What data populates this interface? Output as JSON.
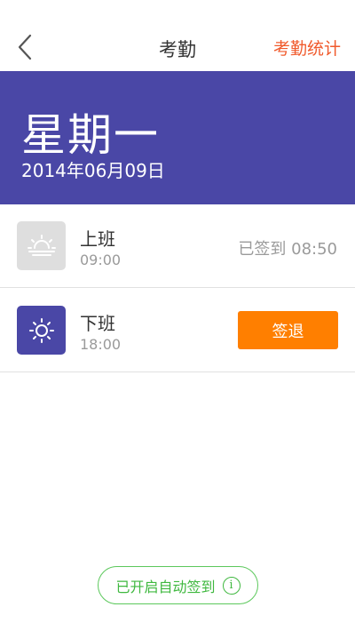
{
  "navbar": {
    "title": "考勤",
    "action_label": "考勤统计",
    "back_icon": "chevron-left-icon"
  },
  "header": {
    "weekday": "星期一",
    "date": "2014年06月09日",
    "background_color": "#4a47a6"
  },
  "rows": [
    {
      "name": "上班",
      "time": "09:00",
      "status": "已签到 08:50",
      "icon": "sunrise-icon"
    },
    {
      "name": "下班",
      "time": "18:00",
      "button_label": "签退",
      "icon": "sun-icon"
    }
  ],
  "auto_sign": {
    "label": "已开启自动签到",
    "info_glyph": "i"
  },
  "colors": {
    "accent": "#f05a2c",
    "button": "#ff7f00",
    "green": "#3fb83f"
  }
}
